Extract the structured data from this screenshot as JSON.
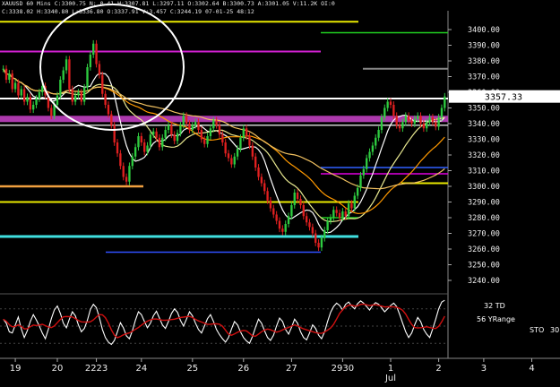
{
  "header": {
    "text": "XAUUSD 60 Mins  C:3300.75  N: 0.41  H:3307.81  L:3297.11  O:3302.64  B:3300.73  A:3301.05  V:11.2K  OI:0",
    "text2": "C:3338.02  H:3340.80  L:3336.80  O:3337.91  V:3.457  C:3244.19  07-01-25  48:12"
  },
  "colors": {
    "background": "#000000",
    "candle_up": "#2ecc40",
    "candle_down": "#e02020",
    "magenta_band": "#c040c0",
    "yellow": "#e8e800",
    "orange": "#ff9900",
    "cyan": "#40e0e0",
    "blue": "#3050ff",
    "stoch_fast": "#ffffff",
    "stoch_slow": "#d01010"
  },
  "price_tag": "3357.33",
  "indicator_labels": {
    "td": "32 TD",
    "yrange": "56 YRange",
    "sto": "STO",
    "sto_value": "30"
  },
  "chart_data": {
    "type": "candlestick",
    "title": "",
    "xlabel": "",
    "ylabel": "",
    "ylim": [
      3232,
      3412
    ],
    "y_ticks": [
      3240,
      3250,
      3260,
      3270,
      3280,
      3290,
      3300,
      3310,
      3320,
      3330,
      3340,
      3350,
      3360,
      3370,
      3380,
      3390,
      3400
    ],
    "x_tick_labels": [
      "19",
      "20",
      "2223",
      "24",
      "25",
      "26",
      "27",
      "2930",
      "1",
      "2",
      "3",
      "4"
    ],
    "x_tick_bars": [
      4,
      18,
      31,
      46,
      63,
      80,
      96,
      113,
      129,
      145,
      160,
      176
    ],
    "x_sublabel": "Jul",
    "x_sublabel_bar": 129,
    "grid": false,
    "closes": [
      3375,
      3368,
      3372,
      3362,
      3366,
      3358,
      3362,
      3354,
      3357,
      3349,
      3352,
      3356,
      3360,
      3364,
      3358,
      3350,
      3345,
      3352,
      3358,
      3368,
      3374,
      3381,
      3362,
      3354,
      3358,
      3360,
      3354,
      3363,
      3376,
      3384,
      3391,
      3378,
      3371,
      3359,
      3352,
      3346,
      3339,
      3328,
      3321,
      3313,
      3306,
      3303,
      3313,
      3319,
      3325,
      3332,
      3328,
      3322,
      3326,
      3333,
      3335,
      3331,
      3325,
      3331,
      3336,
      3339,
      3333,
      3329,
      3334,
      3339,
      3345,
      3340,
      3336,
      3339,
      3341,
      3336,
      3330,
      3327,
      3332,
      3337,
      3342,
      3339,
      3333,
      3328,
      3321,
      3318,
      3314,
      3319,
      3324,
      3331,
      3337,
      3332,
      3326,
      3319,
      3312,
      3306,
      3302,
      3297,
      3291,
      3286,
      3282,
      3278,
      3273,
      3271,
      3276,
      3281,
      3288,
      3296,
      3292,
      3288,
      3281,
      3277,
      3274,
      3270,
      3264,
      3261,
      3267,
      3272,
      3278,
      3280,
      3285,
      3283,
      3280,
      3284,
      3281,
      3289,
      3286,
      3294,
      3299,
      3307,
      3311,
      3318,
      3322,
      3326,
      3331,
      3336,
      3344,
      3350,
      3354,
      3352,
      3345,
      3339,
      3337,
      3341,
      3345,
      3342,
      3340,
      3343,
      3345,
      3340,
      3337,
      3341,
      3344,
      3341,
      3338,
      3344,
      3350,
      3357.33
    ],
    "stoch": [
      62,
      55,
      40,
      38,
      52,
      66,
      45,
      30,
      42,
      58,
      70,
      61,
      50,
      38,
      28,
      44,
      63,
      78,
      85,
      72,
      55,
      47,
      62,
      75,
      68,
      52,
      40,
      46,
      60,
      79,
      88,
      82,
      65,
      44,
      30,
      22,
      18,
      25,
      40,
      56,
      47,
      33,
      28,
      42,
      60,
      75,
      70,
      58,
      47,
      55,
      68,
      76,
      64,
      52,
      46,
      58,
      72,
      80,
      74,
      60,
      50,
      62,
      75,
      68,
      55,
      44,
      38,
      50,
      63,
      70,
      58,
      44,
      35,
      28,
      22,
      30,
      45,
      58,
      52,
      40,
      30,
      24,
      20,
      32,
      48,
      62,
      55,
      42,
      30,
      25,
      34,
      50,
      64,
      58,
      44,
      36,
      48,
      62,
      55,
      40,
      30,
      26,
      38,
      52,
      46,
      34,
      28,
      40,
      58,
      74,
      84,
      90,
      86,
      78,
      88,
      92,
      85,
      80,
      89,
      94,
      90,
      84,
      78,
      86,
      91,
      88,
      82,
      75,
      80,
      86,
      90,
      84,
      70,
      55,
      40,
      30,
      38,
      52,
      65,
      58,
      44,
      36,
      30,
      45,
      62,
      80,
      92,
      95
    ]
  }
}
